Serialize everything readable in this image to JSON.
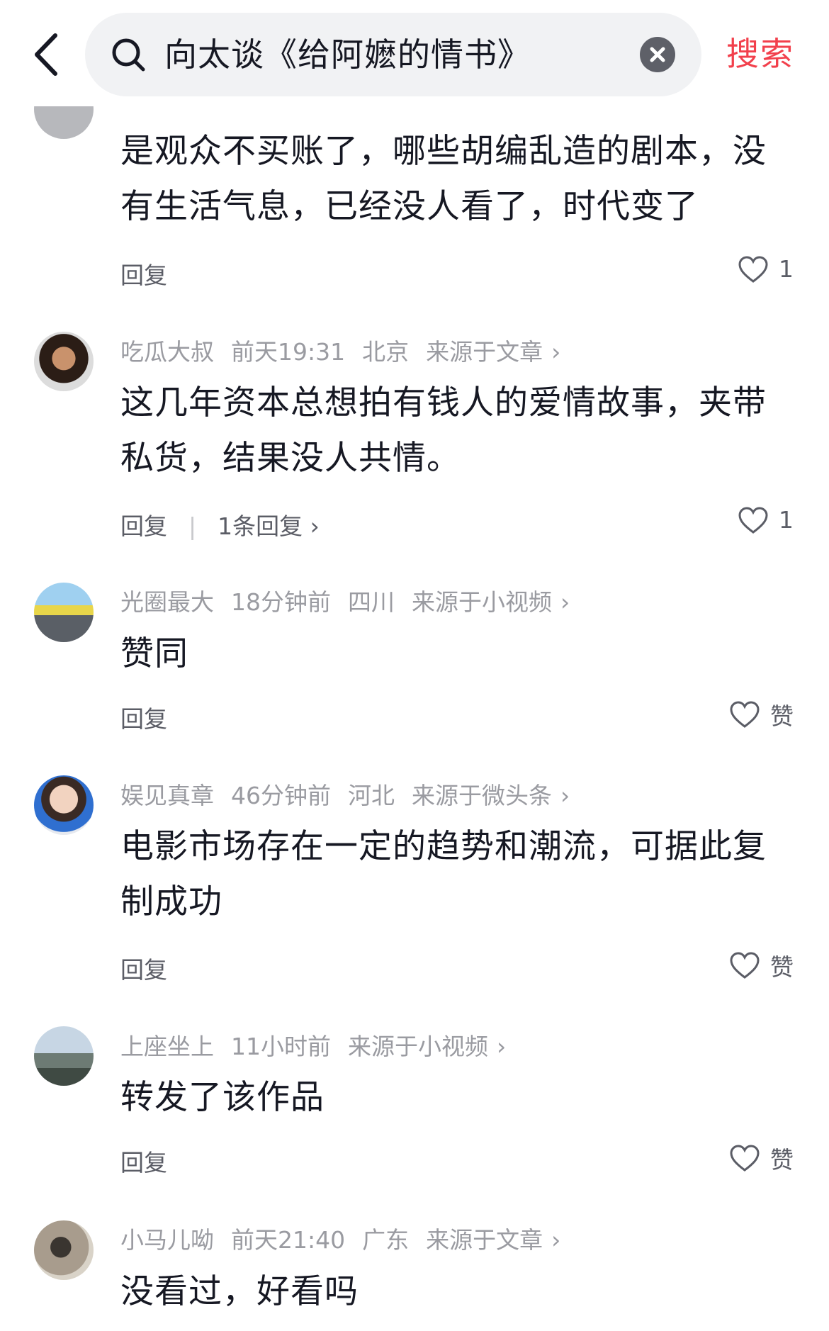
{
  "search": {
    "query": "向太谈《给阿嬷的情书》",
    "button_label": "搜索"
  },
  "comments": [
    {
      "content": "是观众不买账了，哪些胡编乱造的剧本，没有生活气息，已经没人看了，时代变了",
      "reply_label": "回复",
      "likes": "1"
    },
    {
      "username": "吃瓜大叔",
      "time": "前天19:31",
      "location": "北京",
      "source": "来源于文章",
      "content": "这几年资本总想拍有钱人的爱情故事，夹带私货，结果没人共情。",
      "reply_label": "回复",
      "reply_count": "1条回复",
      "likes": "1"
    },
    {
      "username": "光圈最大",
      "time": "18分钟前",
      "location": "四川",
      "source": "来源于小视频",
      "content": "赞同",
      "reply_label": "回复",
      "likes": "赞"
    },
    {
      "username": "娱见真章",
      "time": "46分钟前",
      "location": "河北",
      "source": "来源于微头条",
      "content": "电影市场存在一定的趋势和潮流，可据此复制成功",
      "reply_label": "回复",
      "likes": "赞"
    },
    {
      "username": "上座坐上",
      "time": "11小时前",
      "source": "来源于小视频",
      "content": "转发了该作品",
      "reply_label": "回复",
      "likes": "赞"
    },
    {
      "username": "小马儿呦",
      "time": "前天21:40",
      "location": "广东",
      "source": "来源于文章",
      "content": "没看过，好看吗"
    }
  ],
  "icons": {
    "back": "chevron-left-icon",
    "search": "search-icon",
    "clear": "close-circle-icon",
    "like": "heart-outline-icon",
    "chevron": "chevron-right-icon"
  },
  "colors": {
    "accent": "#f2404c",
    "meta_text": "#9a9ba1",
    "body_text": "#161823",
    "search_bg": "#f1f2f4"
  }
}
